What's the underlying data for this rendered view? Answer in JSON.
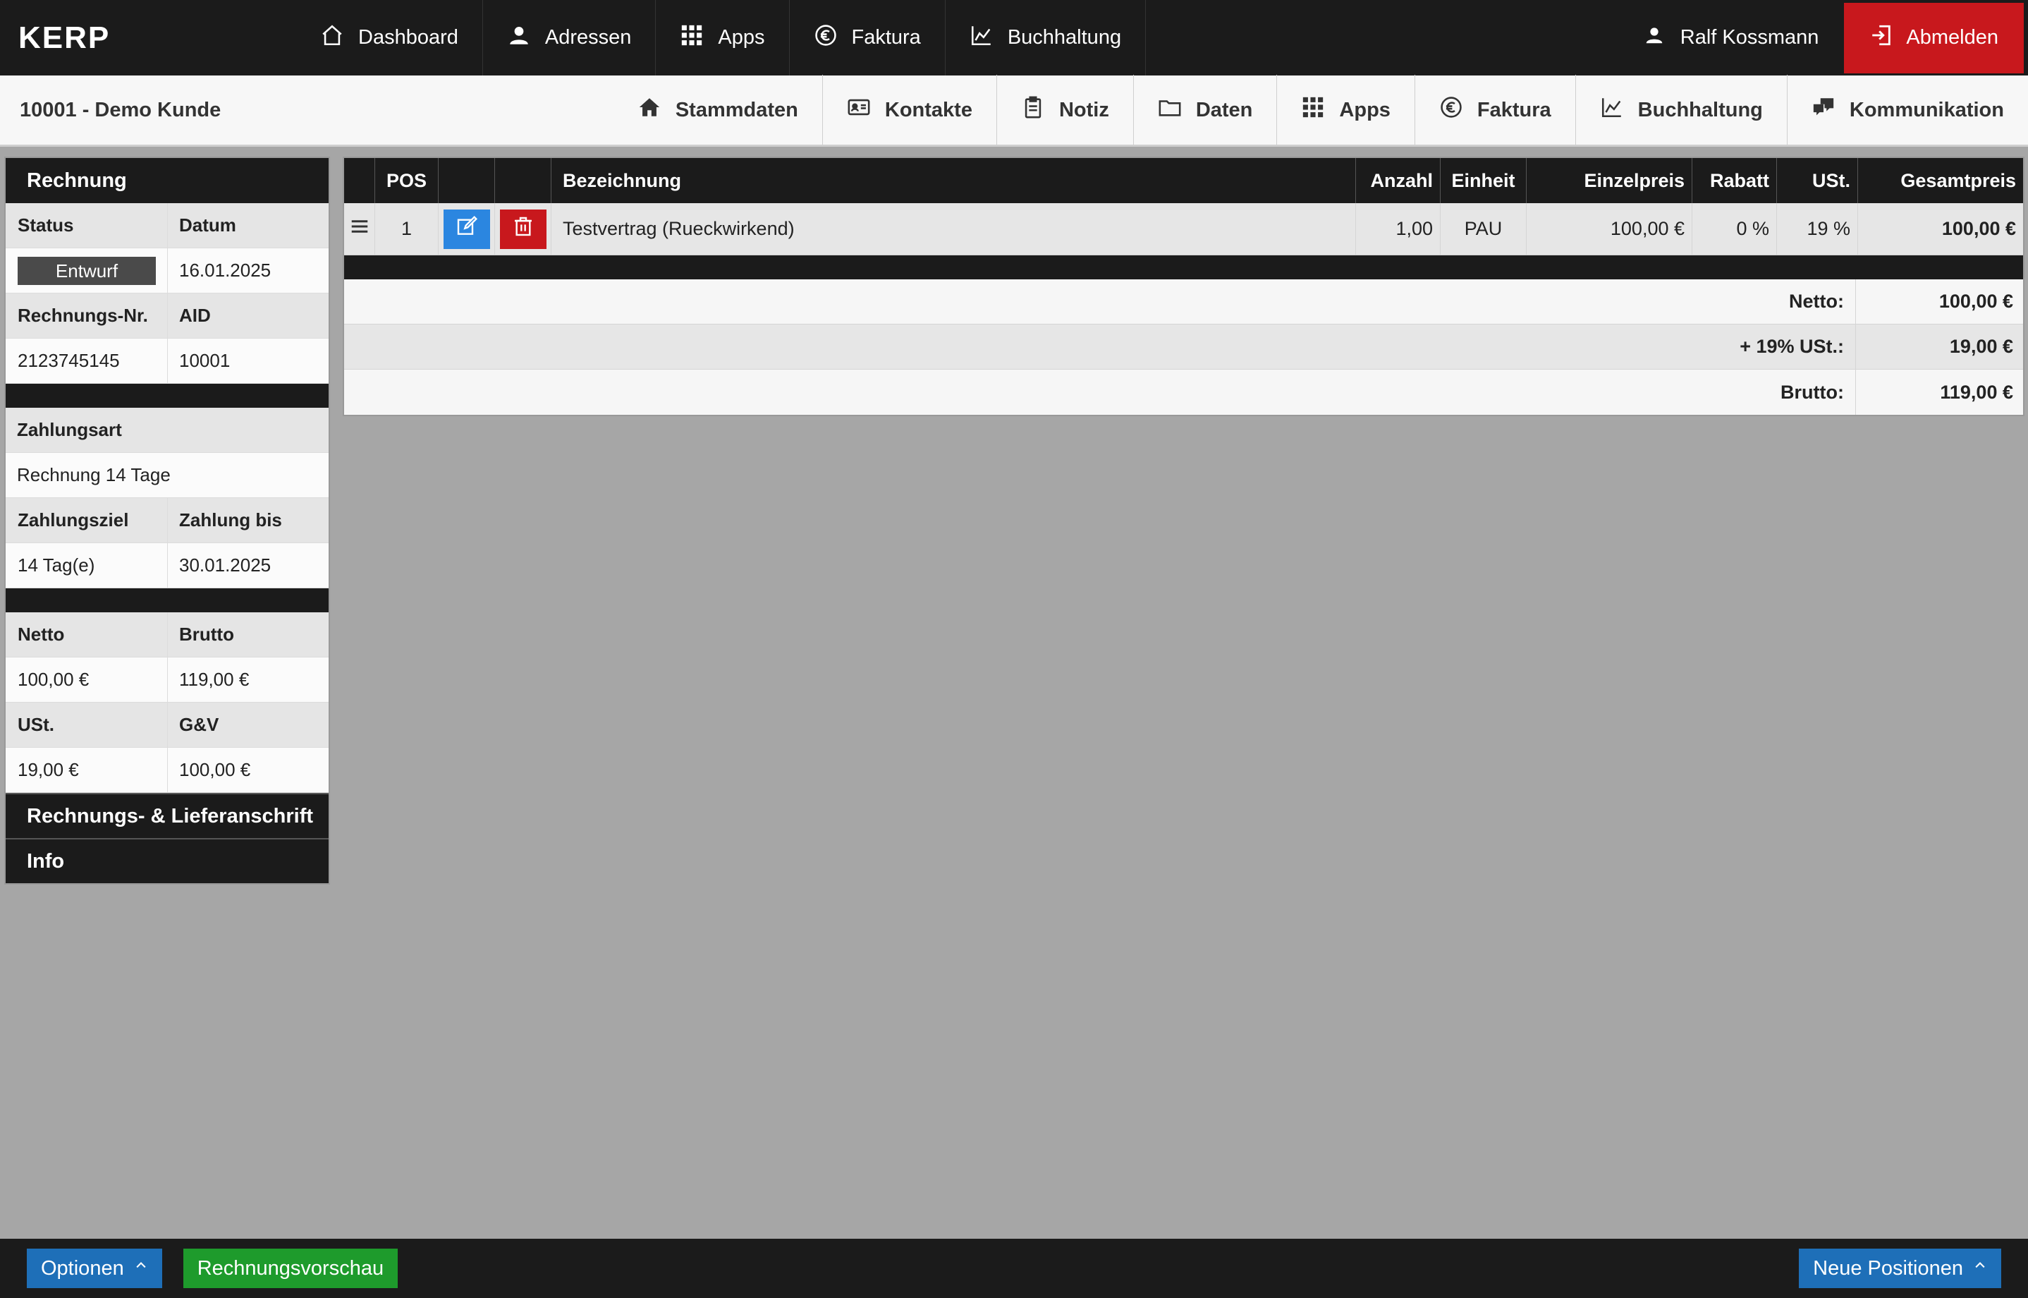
{
  "app": {
    "logo": "KERP"
  },
  "topnav": {
    "items": [
      {
        "label": "Dashboard"
      },
      {
        "label": "Adressen"
      },
      {
        "label": "Apps"
      },
      {
        "label": "Faktura"
      },
      {
        "label": "Buchhaltung"
      }
    ],
    "user": "Ralf Kossmann",
    "logout": "Abmelden"
  },
  "subbar": {
    "title": "10001 - Demo Kunde",
    "items": [
      {
        "label": "Stammdaten"
      },
      {
        "label": "Kontakte"
      },
      {
        "label": "Notiz"
      },
      {
        "label": "Daten"
      },
      {
        "label": "Apps"
      },
      {
        "label": "Faktura"
      },
      {
        "label": "Buchhaltung"
      },
      {
        "label": "Kommunikation"
      }
    ]
  },
  "invoice": {
    "header": "Rechnung",
    "status_label": "Status",
    "status_value": "Entwurf",
    "date_label": "Datum",
    "date_value": "16.01.2025",
    "number_label": "Rechnungs-Nr.",
    "number_value": "2123745145",
    "aid_label": "AID",
    "aid_value": "10001",
    "payment_type_label": "Zahlungsart",
    "payment_type_value": "Rechnung 14 Tage",
    "payment_term_label": "Zahlungsziel",
    "payment_term_value": "14 Tag(e)",
    "payment_due_label": "Zahlung bis",
    "payment_due_value": "30.01.2025",
    "net_label": "Netto",
    "net_value": "100,00 €",
    "gross_label": "Brutto",
    "gross_value": "119,00 €",
    "vat_label": "USt.",
    "vat_value": "19,00 €",
    "gv_label": "G&V",
    "gv_value": "100,00 €",
    "address_section": "Rechnungs- & Lieferanschrift",
    "info_section": "Info"
  },
  "positions": {
    "columns": {
      "pos": "POS",
      "name": "Bezeichnung",
      "qty": "Anzahl",
      "unit": "Einheit",
      "price": "Einzelpreis",
      "discount": "Rabatt",
      "vat": "USt.",
      "total": "Gesamtpreis"
    },
    "rows": [
      {
        "pos": "1",
        "name": "Testvertrag (Rueckwirkend)",
        "qty": "1,00",
        "unit": "PAU",
        "price": "100,00 €",
        "discount": "0 %",
        "vat": "19 %",
        "total": "100,00 €"
      }
    ],
    "totals": {
      "net_label": "Netto:",
      "net_value": "100,00 €",
      "vat_label": "+ 19% USt.:",
      "vat_value": "19,00 €",
      "gross_label": "Brutto:",
      "gross_value": "119,00 €"
    }
  },
  "bottombar": {
    "options": "Optionen",
    "preview": "Rechnungsvorschau",
    "new_positions": "Neue Positionen"
  },
  "colors": {
    "dark": "#1b1b1b",
    "logout_red": "#c8181d",
    "edit_blue": "#2b86e0",
    "bottom_blue": "#1e6fb8",
    "preview_green": "#1e9b2c",
    "background": "#a6a6a6"
  },
  "icons": {
    "dashboard": "home-icon",
    "adressen": "user-icon",
    "apps": "grid-icon",
    "faktura": "euro-icon",
    "buchhaltung": "chart-icon",
    "user": "user-icon",
    "logout": "logout-icon",
    "stammdaten": "home-icon",
    "kontakte": "id-card-icon",
    "notiz": "clipboard-icon",
    "daten": "folder-icon",
    "kommunikation": "chat-icon",
    "edit": "edit-icon",
    "delete": "trash-icon",
    "handle": "drag-handle-icon"
  }
}
